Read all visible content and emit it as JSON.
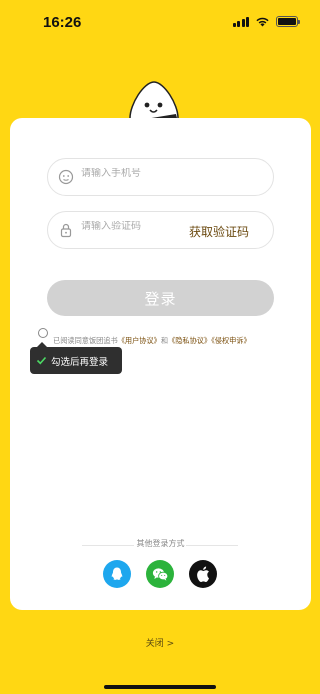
{
  "status_bar": {
    "time": "16:26",
    "icons": [
      "signal-icon",
      "wifi-icon",
      "battery-icon"
    ]
  },
  "colors": {
    "background": "#FFD713",
    "card": "#FFFFFF",
    "login_button_disabled": "#D2D2D2",
    "link": "#7A4E0C",
    "qq": "#1EA7EE",
    "wechat": "#2CB33C",
    "apple": "#111111"
  },
  "form": {
    "phone": {
      "placeholder": "请输入手机号",
      "value": "",
      "icon": "user-face-icon"
    },
    "code": {
      "placeholder": "请输入验证码",
      "value": "",
      "icon": "lock-icon"
    },
    "get_code_label": "获取验证码",
    "login_label": "登录"
  },
  "agreement": {
    "checked": false,
    "prefix": "已阅读同意饭团追书",
    "user_agreement": "《用户协议》",
    "and": "和",
    "privacy_agreement": "《隐私协议》",
    "complaint": "《侵权申诉》"
  },
  "tooltip": {
    "text": "勾选后再登录",
    "icon": "check-icon"
  },
  "other_login": {
    "title": "其他登录方式",
    "methods": [
      "qq-icon",
      "wechat-icon",
      "apple-icon"
    ]
  },
  "close_label": "关闭 >"
}
